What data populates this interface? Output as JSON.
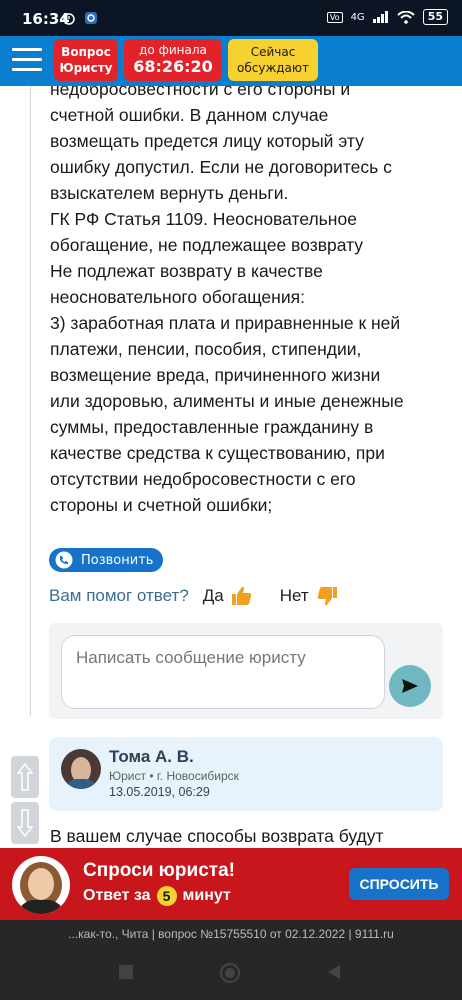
{
  "status_bar": {
    "time": "16:34",
    "battery": "55",
    "network": "4G"
  },
  "header": {
    "ask_button": "Вопрос Юристу",
    "timer_label": "до финала",
    "timer_value": "68:26:20",
    "now_discussing": "Сейчас обсуждают"
  },
  "answer": {
    "text": "недобросовестности с его стороны и\nсчетной ошибки. В данном случае\nвозмещать предется лицу который эту\nошибку допустил. Если не договоритесь с\nвзыскателем вернуть деньги.\nГК РФ Статья 1109. Неосновательное\nобогащение, не подлежащее возврату\nНе подлежат возврату в качестве\nнеосновательного обогащения:\n3) заработная плата и приравненные к ней\nплатежи, пенсии, пособия, стипендии,\nвозмещение вреда, причиненного жизни\nили здоровью, алименты и иные денежные\nсуммы, предоставленные гражданину в\nкачестве средства к существованию, при\nотсутствии недобросовестности с его\nстороны и счетной ошибки;",
    "call_button": "Позвонить",
    "helpful_question": "Вам помог ответ?",
    "yes": "Да",
    "no": "Нет"
  },
  "message": {
    "placeholder": "Написать сообщение юристу"
  },
  "lawyer": {
    "name": "Тома А. В.",
    "role": "Юрист",
    "city": "г. Новосибирск",
    "date": "13.05.2019, 06:29"
  },
  "next_answer_preview": "В вашем случае способы возврата будут",
  "promo": {
    "title": "Спроси юриста!",
    "subtitle_pre": "Ответ за",
    "minutes": "5",
    "subtitle_post": "минут",
    "button": "СПРОСИТЬ"
  },
  "footer": "...как-то., Чита | вопрос №15755510 от 02.12.2022 | 9111.ru",
  "colors": {
    "brand_blue": "#0a7fd0",
    "accent_red": "#e3232a",
    "accent_yellow": "#f6d130",
    "promo_red": "#c8161d"
  }
}
